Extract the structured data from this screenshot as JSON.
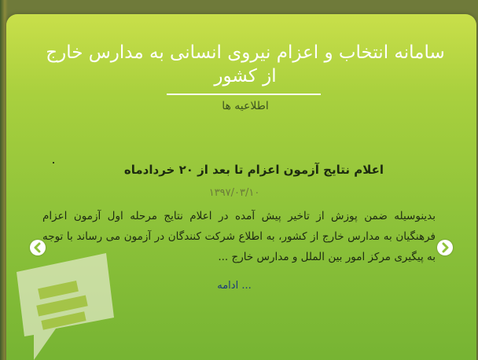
{
  "header": {
    "title": "سامانه انتخاب و اعزام نیروی انسانی به مدارس خارج از کشور",
    "subtitle": "اطلاعیه ها"
  },
  "news": {
    "title": "اعلام نتایج آزمون اعزام تا بعد از ۲۰ خردادماه",
    "date": "۱۳۹۷/۰۳/۱۰",
    "body": "بدینوسیله ضمن پوزش از تاخیر  پیش آمده در اعلام نتایج مرحله اول آزمون اعزام فرهنگیان به مدارس خارج از کشور، به اطلاع  شرکت کنندگان در آزمون  می رساند با توجه به پیگیری مرکز امور بین الملل و مدارس خارج ...",
    "more_label": "... ادامه"
  },
  "icons": {
    "prev": "chevron-left-icon",
    "next": "chevron-right-icon",
    "watermark": "message-bubble-icon"
  },
  "colors": {
    "card_top": "#c9df4a",
    "card_bottom": "#74b232",
    "title": "#ffffff",
    "link": "#1b3a7a"
  }
}
